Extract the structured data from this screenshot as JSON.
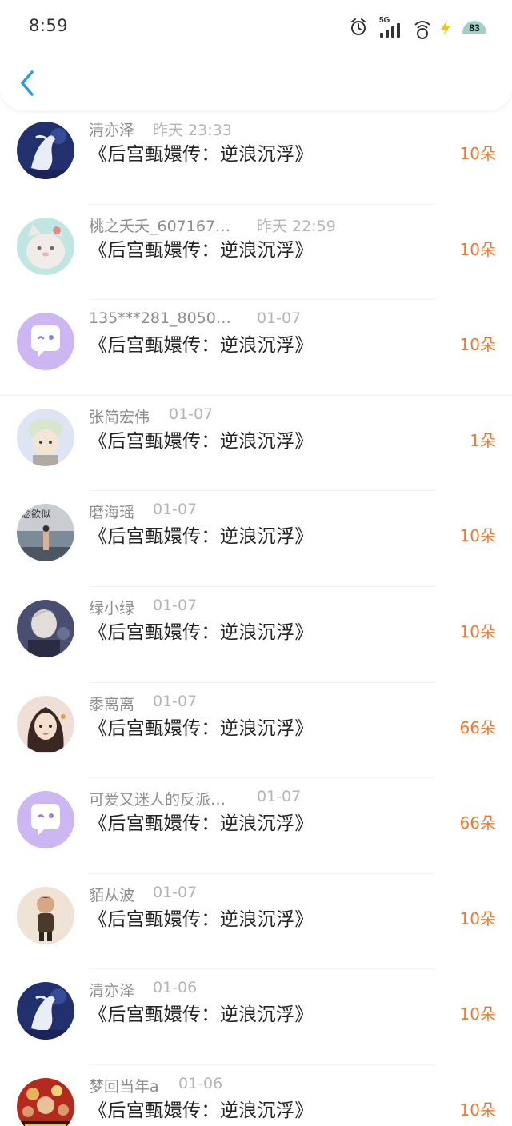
{
  "status_bar": {
    "time": "8:59",
    "network": "5G",
    "battery": "83",
    "icons": [
      "alarm-icon",
      "signal-icon",
      "wifi-icon",
      "charging-icon",
      "battery-icon"
    ]
  },
  "nav": {
    "back_icon": "chevron-left-icon"
  },
  "colors": {
    "accent": "#f0782d",
    "back": "#2a9de0",
    "name": "#8d8d8d",
    "date": "#b5b5b5"
  },
  "gifts": [
    {
      "name": "清亦泽",
      "date": "昨天 23:33",
      "title": "《后宫甄嬛传：逆浪沉浮》",
      "amount": "10朵",
      "avatar": "white-horse-avatar"
    },
    {
      "name": "桃之夭夭_607167…",
      "date": "昨天 22:59",
      "title": "《后宫甄嬛传：逆浪沉浮》",
      "amount": "10朵",
      "avatar": "cat-avatar"
    },
    {
      "name": "135***281_8050…",
      "date": "01-07",
      "title": "《后宫甄嬛传：逆浪沉浮》",
      "amount": "10朵",
      "avatar": "default-chat-avatar"
    },
    {
      "name": "张简宏伟",
      "date": "01-07",
      "title": "《后宫甄嬛传：逆浪沉浮》",
      "amount": "1朵",
      "avatar": "cartoon-avatar"
    },
    {
      "name": "磨海瑶",
      "date": "01-07",
      "title": "《后宫甄嬛传：逆浪沉浮》",
      "amount": "10朵",
      "avatar": "seaside-photo-avatar",
      "avatar_text": "念欲似"
    },
    {
      "name": "绿小绿",
      "date": "01-07",
      "title": "《后宫甄嬛传：逆浪沉浮》",
      "amount": "10朵",
      "avatar": "portrait-avatar"
    },
    {
      "name": "黍离离",
      "date": "01-07",
      "title": "《后宫甄嬛传：逆浪沉浮》",
      "amount": "66朵",
      "avatar": "anime-girl-avatar"
    },
    {
      "name": "可爱又迷人的反派…",
      "date": "01-07",
      "title": "《后宫甄嬛传：逆浪沉浮》",
      "amount": "66朵",
      "avatar": "default-chat-avatar"
    },
    {
      "name": "貊从波",
      "date": "01-07",
      "title": "《后宫甄嬛传：逆浪沉浮》",
      "amount": "10朵",
      "avatar": "figure-avatar"
    },
    {
      "name": "清亦泽",
      "date": "01-06",
      "title": "《后宫甄嬛传：逆浪沉浮》",
      "amount": "10朵",
      "avatar": "white-horse-avatar"
    },
    {
      "name": "梦回当年a",
      "date": "01-06",
      "title": "《后宫甄嬛传：逆浪沉浮》",
      "amount": "10朵",
      "avatar": "movie-poster-avatar"
    }
  ]
}
